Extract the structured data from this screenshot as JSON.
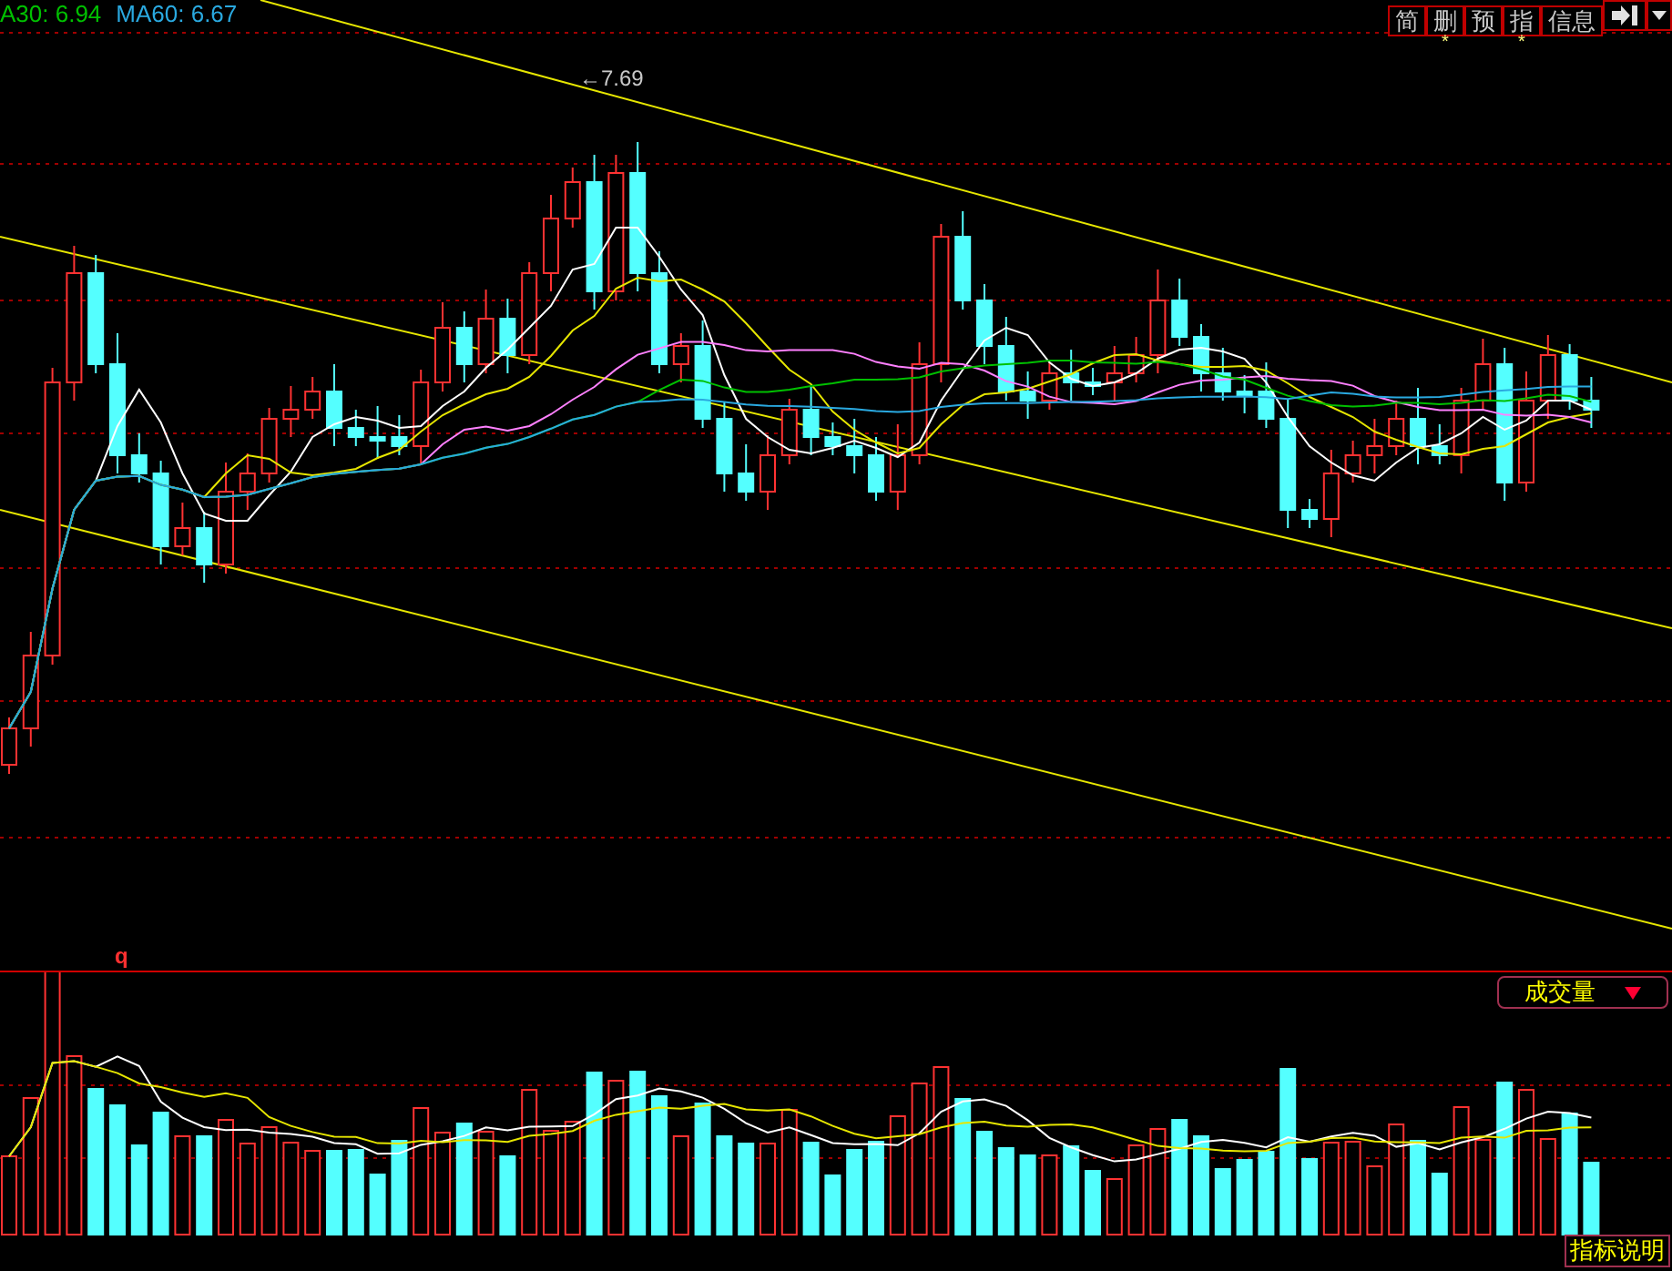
{
  "legend": [
    {
      "label": "A30: 6.94",
      "color": "#00c000"
    },
    {
      "label": "MA60: 6.67",
      "color": "#2aa9e0"
    }
  ],
  "toolbar": {
    "buttons": [
      {
        "label": "简"
      },
      {
        "label": "删",
        "mark": "*"
      },
      {
        "label": "预"
      },
      {
        "label": "指",
        "mark": "*"
      },
      {
        "label": "信息"
      }
    ]
  },
  "price_chart": {
    "high_label": "←7.69",
    "marker": "q"
  },
  "volume_panel": {
    "indicator": "成交量",
    "help_button": "指标说明"
  }
}
